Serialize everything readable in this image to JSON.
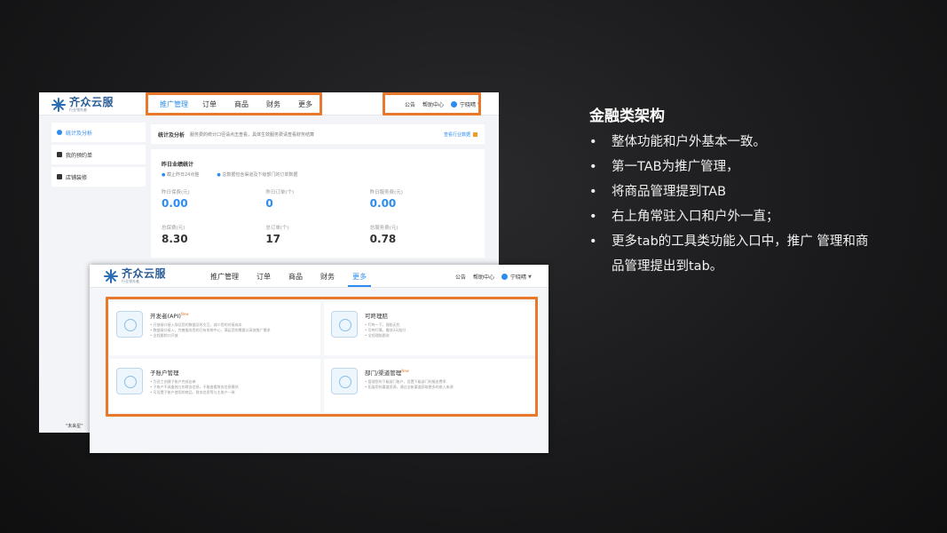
{
  "shot1": {
    "logo": {
      "name": "齐众云服",
      "slogan": "行业领先者"
    },
    "nav": [
      "推广管理",
      "订单",
      "商品",
      "财务",
      "更多"
    ],
    "utils": {
      "notice": "公告",
      "help": "帮助中心",
      "user": "宁晓晴"
    },
    "sidebar": [
      "统计及分析",
      "我的预约单",
      "店铺装修"
    ],
    "sidebar_footer": "\"未来星\"",
    "banner": {
      "title": "统计及分析",
      "desc": "服务费的统计口径请点击查看，具体生效服务费请查看财务结算",
      "link": "查看行业数据"
    },
    "stats": {
      "title": "昨日业绩统计",
      "note1": "截止昨日24点整",
      "note2": "总数据包含渠道及下级部门的订单数据",
      "items": [
        {
          "label": "昨日保费(元)",
          "value": "0.00"
        },
        {
          "label": "昨日订单(个)",
          "value": "0"
        },
        {
          "label": "昨日服务费(元)",
          "value": "0.00"
        },
        {
          "label": "总保费(元)",
          "value": "8.30"
        },
        {
          "label": "总订单(个)",
          "value": "17"
        },
        {
          "label": "总服务费(元)",
          "value": "0.78"
        }
      ]
    }
  },
  "shot2": {
    "logo": {
      "name": "齐众云服",
      "slogan": "行业领先者"
    },
    "nav": [
      "推广管理",
      "订单",
      "商品",
      "财务",
      "更多"
    ],
    "utils": {
      "notice": "公告",
      "help": "帮助中心",
      "user": "宁晓晴"
    },
    "cards": [
      {
        "title": "开发者(API)",
        "badge": "New",
        "lines": [
          "• 开放接口接入保证您的数据及时交互，减少您的对接成本",
          "• 数据接口接入，完善服务您的已有系统中心，满足您的需要以高效推广需求",
          "• 全程跟踪口开放"
        ]
      },
      {
        "title": "可咚理赔",
        "badge": "",
        "lines": [
          "• 叮咚一下，理赔无忧",
          "• 可咚叮嘱，最快3天赔付",
          "• 全程理赔跟进"
        ]
      },
      {
        "title": "子账户管理",
        "badge": "",
        "lines": [
          "• 为员工创建子账户完成出单",
          "• 子账户不具备独立的财务信息，不能查看财务信息模块",
          "• 可设置子账户使用的商品、财务信息等与主账户一致"
        ]
      },
      {
        "title": "部门/渠道管理",
        "badge": "New",
        "lines": [
          "• 管理您的下级部门账户，设置下级部门的服务费率",
          "• 拓展您的渠道资源，通过全新渠道获取更多的收入来源"
        ]
      }
    ]
  },
  "right": {
    "title": "金融类架构",
    "bullets": [
      "整体功能和户外基本一致。",
      "第一TAB为推广管理，",
      "将商品管理提到TAB",
      "右上角常驻入口和户外一直；",
      "更多tab的工具类功能入口中，推广 管理和商品管理提出到tab。"
    ]
  },
  "colors": {
    "accent": "#2d8cf0",
    "highlight": "#e8782c",
    "brand": "#2a5d96"
  }
}
